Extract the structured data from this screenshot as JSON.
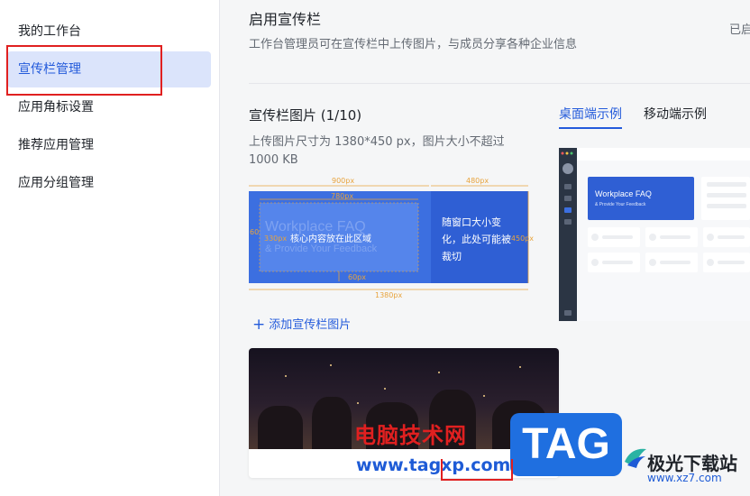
{
  "sidebar": {
    "items": [
      {
        "label": "我的工作台"
      },
      {
        "label": "宣传栏管理"
      },
      {
        "label": "应用角标设置"
      },
      {
        "label": "推荐应用管理"
      },
      {
        "label": "应用分组管理"
      }
    ],
    "active_index": 1
  },
  "header": {
    "title": "启用宣传栏",
    "description": "工作台管理员可在宣传栏中上传图片，与成员分享各种企业信息",
    "status": "已启"
  },
  "banner_section": {
    "title": "宣传栏图片 (1/10)",
    "hint": "上传图片尺寸为 1380*450 px，图片大小不超过 1000 KB",
    "add_label": "添加宣传栏图片",
    "tabs": [
      {
        "label": "桌面端示例"
      },
      {
        "label": "移动端示例"
      }
    ],
    "active_tab": 0
  },
  "spec_diagram": {
    "dim_900": "900px",
    "dim_480": "480px",
    "dim_780": "780px",
    "dim_60_left": "60",
    "dim_330": "330px",
    "dim_60_bottom": "60px",
    "dim_450": "450px",
    "dim_1380": "1380px",
    "core_label": "核心内容放在此区域",
    "resize_label_1": "随窗口大小变",
    "resize_label_2": "化，此处可能被",
    "resize_label_3": "裁切",
    "ghost_1": "Workplace FAQ",
    "ghost_2": "& Provide Your Feedback"
  },
  "desktop_preview": {
    "card_title": "Workplace FAQ",
    "card_sub": "& Provide Your Feedback"
  },
  "watermark": {
    "text": "电脑技术网",
    "url": "www.tagxp.com",
    "tag": "TAG",
    "site": "极光下载站",
    "site_url": "www.xz7.com"
  },
  "colors": {
    "accent": "#245bdb",
    "spec_blue": "#3c6fe0",
    "dim_orange": "#e8a33c",
    "highlight_red": "#e02020"
  }
}
